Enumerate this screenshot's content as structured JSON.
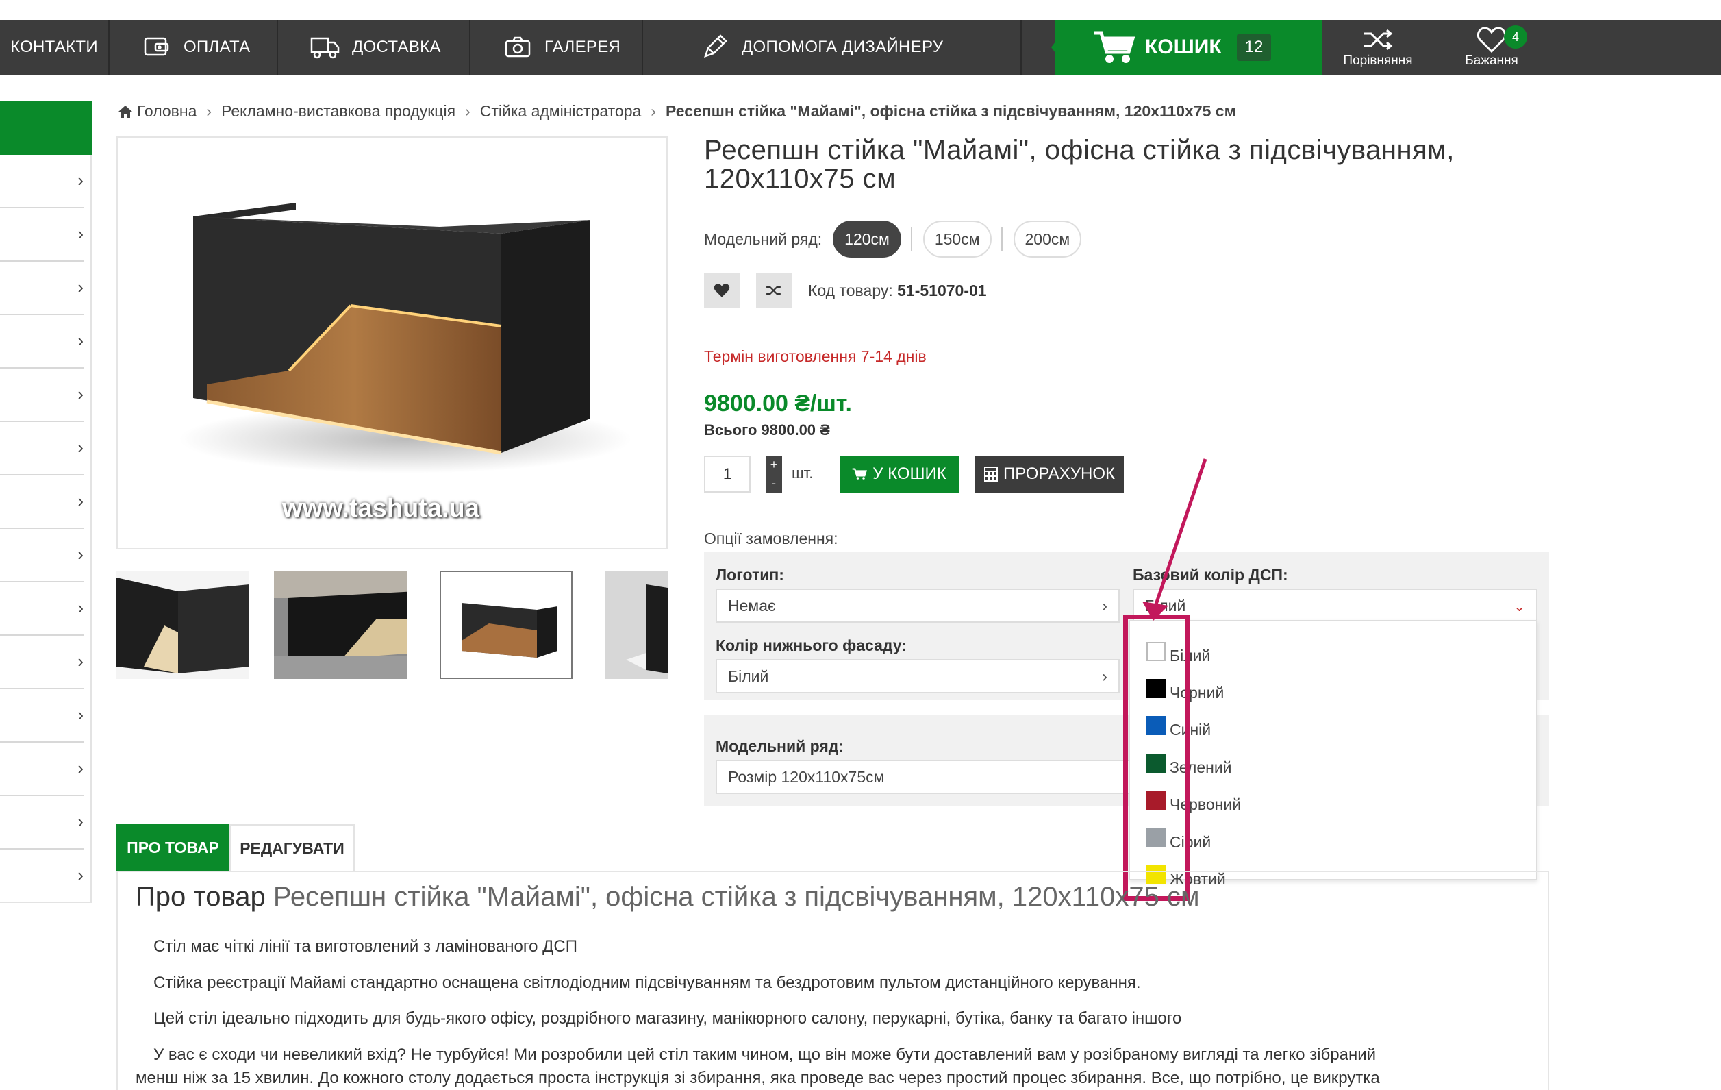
{
  "nav": {
    "items": [
      {
        "label": "КОНТАКТИ",
        "icon": "none"
      },
      {
        "label": "ОПЛАТА",
        "icon": "wallet-icon"
      },
      {
        "label": "ДОСТАВКА",
        "icon": "truck-icon"
      },
      {
        "label": "ГАЛЕРЕЯ",
        "icon": "camera-icon"
      },
      {
        "label": "ДОПОМОГА ДИЗАЙНЕРУ",
        "icon": "pencil-icon"
      }
    ],
    "cart": {
      "label": "КОШИК",
      "count": "12"
    },
    "compare": {
      "label": "Порівняння"
    },
    "wishlist": {
      "label": "Бажання",
      "count": "4"
    }
  },
  "breadcrumb": {
    "home": "Головна",
    "level1": "Рекламно-виставкова продукція",
    "level2": "Стійка адміністратора",
    "current": "Ресепшн стійка \"Майамі\", офісна стійка з підсвічуванням, 120x110x75 см"
  },
  "product": {
    "title": "Ресепшн стійка \"Майамі\", офісна стійка з підсвічуванням, 120x110x75 см",
    "model_label": "Модельний ряд:",
    "models": [
      "120см",
      "150см",
      "200см"
    ],
    "selected_model": "120см",
    "code_label": "Код товару:",
    "code": "51-51070-01",
    "term": "Термін виготовлення 7-14 днів",
    "price": "9800.00 ₴/шт.",
    "total": "Всього 9800.00 ₴",
    "qty": "1",
    "unit": "шт.",
    "add_to_cart": "У КОШИК",
    "calc": "ПРОРАХУНОК",
    "watermark": "www.tashuta.ua"
  },
  "options": {
    "label": "Опції замовлення:",
    "logo": {
      "title": "Логотип:",
      "value": "Немає"
    },
    "base_color": {
      "title": "Базовий колір ДСП:",
      "value": "Білий"
    },
    "bottom_color": {
      "title": "Колір нижнього фасаду:",
      "value": "Білий"
    },
    "model": {
      "title": "Модельний ряд:",
      "value": "Розмір 120x110x75см"
    }
  },
  "dropdown": {
    "items": [
      {
        "label": "Білий",
        "color": "#ffffff"
      },
      {
        "label": "Чорний",
        "color": "#000000"
      },
      {
        "label": "Синій",
        "color": "#0a5cb8"
      },
      {
        "label": "Зелений",
        "color": "#0b5a2e"
      },
      {
        "label": "Червоний",
        "color": "#a81b2a"
      },
      {
        "label": "Сірий",
        "color": "#9aa0a6"
      },
      {
        "label": "Жовтий",
        "color": "#f2e400"
      }
    ]
  },
  "tabs": {
    "about": "ПРО ТОВАР",
    "edit": "РЕДАГУВАТИ"
  },
  "description": {
    "title_prefix": "Про товар",
    "title_rest": "Ресепшн стійка \"Майамі\", офісна стійка з підсвічуванням, 120x110x75 см",
    "p1": "Стіл має чіткі лінії та виготовлений з ламінованого ДСП",
    "p2": "Стійка реєстрації Майамі стандартно оснащена світлодіодним підсвічуванням та бездротовим пультом дистанційного керування.",
    "p3": "Цей стіл ідеально підходить для будь-якого офісу, роздрібного магазину, манікюрного салону, перукарні, бутіка, банку та багато іншого",
    "p4a": "У вас є сходи чи невеликий вхід? Не турбуйся! Ми розробили цей стіл таким чином, що він може бути доставлений вам у розібраному вигляді та легко зібраний",
    "p4b": "менш ніж за 15 хвилин. До кожного столу додається проста інструкція зі збирання, яка проведе вас через простий процес збирання. Все, що потрібно, це викрутка"
  },
  "colors": {
    "accent": "#0a8a2a",
    "dark": "#3c3c3c",
    "highlight": "#c2185b",
    "term": "#c62828"
  }
}
